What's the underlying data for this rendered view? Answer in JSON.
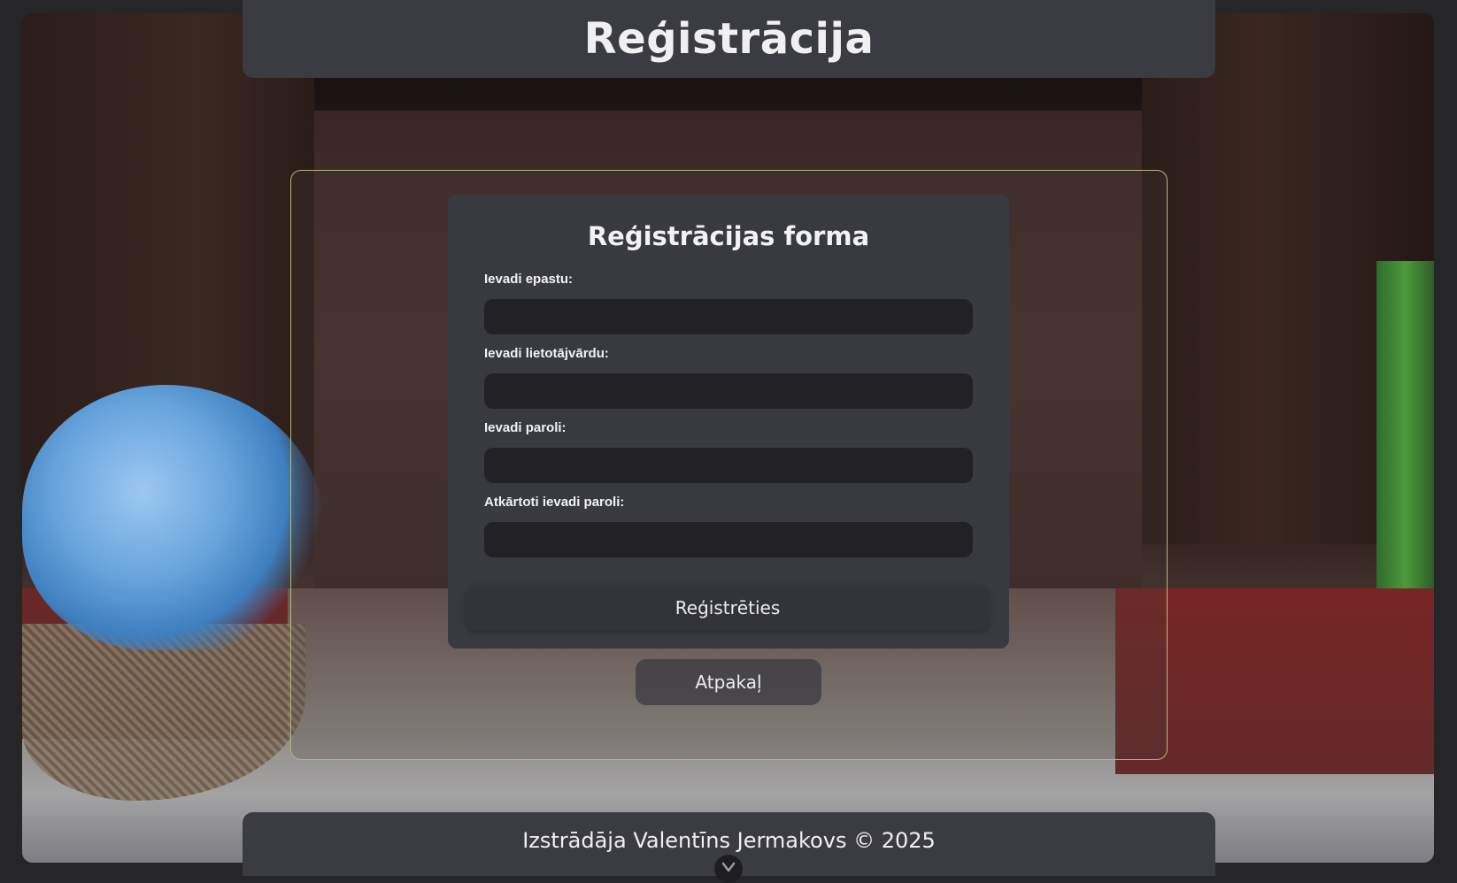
{
  "header": {
    "title": "Reģistrācija"
  },
  "form": {
    "title": "Reģistrācijas forma",
    "fields": [
      {
        "label": "Ievadi epastu:",
        "value": "",
        "placeholder": ""
      },
      {
        "label": "Ievadi lietotājvārdu:",
        "value": "",
        "placeholder": ""
      },
      {
        "label": "Ievadi paroli:",
        "value": "",
        "placeholder": ""
      },
      {
        "label": "Atkārtoti ievadi paroli:",
        "value": "",
        "placeholder": ""
      }
    ],
    "submit_label": "Reģistrēties"
  },
  "back_label": "Atpakaļ",
  "footer": {
    "text": "Izstrādāja Valentīns Jermakovs © 2025",
    "scroll_icon": "chevron-down-icon"
  },
  "colors": {
    "panel": "#3b3b42",
    "card": "#393a40",
    "input": "#222226",
    "accent_border": "#b4b87a"
  }
}
